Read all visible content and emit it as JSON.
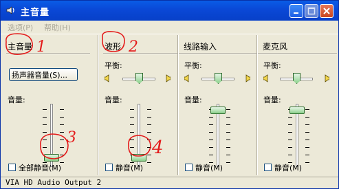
{
  "window": {
    "title": "主音量"
  },
  "menu": {
    "options": "选项(P)",
    "help": "帮助(H)"
  },
  "panels": [
    {
      "title": "主音量",
      "speaker_button": "扬声器音量(S)...",
      "volume_label": "音量:",
      "mute_label": "全部静音(M)",
      "volume_level": 0.1
    },
    {
      "title": "波形",
      "balance_label": "平衡:",
      "volume_label": "音量:",
      "mute_label": "静音(M)",
      "volume_level": 0.1
    },
    {
      "title": "线路输入",
      "balance_label": "平衡:",
      "volume_label": "音量:",
      "mute_label": "静音(M)",
      "volume_level": 0.95
    },
    {
      "title": "麦克风",
      "balance_label": "平衡:",
      "volume_label": "音量:",
      "mute_label": "静音(M)",
      "volume_level": 0.95
    }
  ],
  "annotations": [
    "1",
    "2",
    "3",
    "4"
  ],
  "status": {
    "device": "VIA HD Audio Output 2"
  }
}
